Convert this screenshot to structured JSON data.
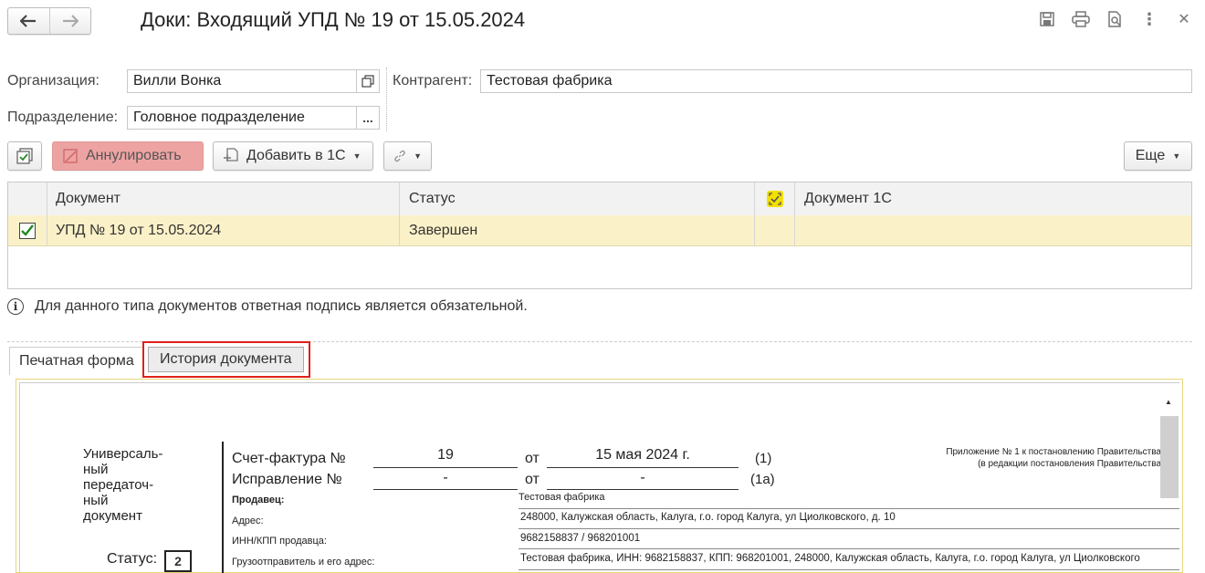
{
  "header": {
    "title": "Доки: Входящий УПД № 19 от 15.05.2024"
  },
  "form": {
    "org_label": "Организация:",
    "org_value": "Вилли Вонка",
    "contractor_label": "Контрагент:",
    "contractor_value": "Тестовая фабрика",
    "division_label": "Подразделение:",
    "division_value": "Головное подразделение",
    "division_btn": "..."
  },
  "toolbar": {
    "cancel_label": "Аннулировать",
    "add_label": "Добавить в 1С",
    "more_label": "Еще"
  },
  "table": {
    "columns": [
      "Документ",
      "Статус",
      "Документ 1С"
    ],
    "rows": [
      {
        "document": "УПД № 19 от 15.05.2024",
        "status": "Завершен",
        "doc1c": ""
      }
    ]
  },
  "info_text": "Для данного типа документов ответная подпись является обязательной.",
  "tabs": [
    "Печатная форма",
    "История документа"
  ],
  "print": {
    "doc_type": [
      "Универсаль-",
      "ный",
      "передаточ-",
      "ный",
      "документ"
    ],
    "status_label": "Статус:",
    "status_value": "2",
    "invoice_label": "Счет-фактура №",
    "invoice_no": "19",
    "from": "от",
    "invoice_date": "15 мая 2024 г.",
    "invoice_code": "(1)",
    "correction_label": "Исправление №",
    "correction_no": "-",
    "correction_date": "-",
    "correction_code": "(1а)",
    "annex_line1": "Приложение № 1 к постановлению Правительства",
    "annex_line2": "(в редакции постановления Правительства",
    "seller_label": "Продавец:",
    "seller_value": "Тестовая фабрика",
    "address_label": "Адрес:",
    "address_value": "248000, Калужская область, Калуга, г.о. город Калуга, ул Циолковского, д. 10",
    "inn_label": "ИНН/КПП продавца:",
    "inn_value": "9682158837 / 968201001",
    "shipper_label": "Грузоотправитель и его адрес:",
    "shipper_value": "Тестовая фабрика, ИНН: 9682158837, КПП: 968201001, 248000, Калужская область, Калуга, г.о. город Калуга, ул Циолковского"
  }
}
